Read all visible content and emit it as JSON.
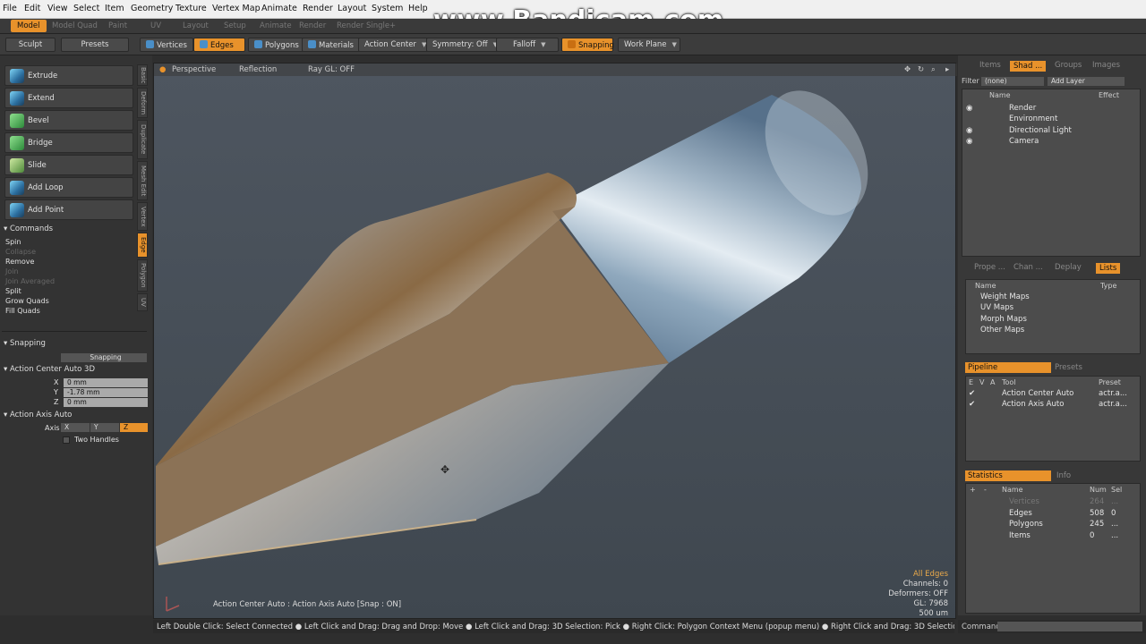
{
  "menu": [
    "File",
    "Edit",
    "View",
    "Select",
    "Item",
    "Geometry",
    "Texture",
    "Vertex Map",
    "Animate",
    "Render",
    "Layout",
    "System",
    "Help"
  ],
  "watermark": "www.Bandicam.com",
  "layout_tabs": [
    "Model",
    "Model Quad",
    "Paint",
    "UV",
    "Layout",
    "Setup",
    "Animate",
    "Render",
    "Render Single",
    "+"
  ],
  "toolbar": {
    "sculpt": "Sculpt",
    "presets": "Presets",
    "vertices": "Vertices",
    "edges": "Edges",
    "polygons": "Polygons",
    "materials": "Materials",
    "action_center": "Action Center",
    "symmetry": "Symmetry: Off",
    "falloff": "Falloff",
    "snapping": "Snapping",
    "work_plane": "Work Plane"
  },
  "tools": [
    "Extrude",
    "Extend",
    "Bevel",
    "Bridge",
    "Slide",
    "Add Loop",
    "Add Point"
  ],
  "vertical_tabs": [
    "Basic",
    "Deform",
    "Duplicate",
    "Mesh Edit",
    "Vertex",
    "Edge",
    "Polygon",
    "UV"
  ],
  "commands": {
    "header": "Commands",
    "items": [
      "Spin",
      "Collapse",
      "Remove",
      "Join",
      "Join Averaged",
      "Split",
      "Grow Quads",
      "Fill Quads"
    ],
    "disabled": [
      "Collapse",
      "Join",
      "Join Averaged"
    ]
  },
  "snapping": {
    "header": "Snapping",
    "field": "Snapping"
  },
  "action_center": {
    "header": "Action Center Auto 3D",
    "x_label": "X",
    "x": "0 mm",
    "y_label": "Y",
    "y": "-1.78 mm",
    "z_label": "Z",
    "z": "0 mm"
  },
  "action_axis": {
    "header": "Action Axis Auto",
    "axis_label": "Axis",
    "x": "X",
    "y": "Y",
    "z": "Z",
    "two_handles": "Two Handles"
  },
  "viewport": {
    "perspective": "Perspective",
    "reflection": "Reflection",
    "raygl": "Ray GL: OFF",
    "hud": "Action Center Auto : Action Axis Auto  [Snap : ON]",
    "info": [
      "All Edges",
      "Channels: 0",
      "Deformers: OFF",
      "GL: 7968",
      "500 um"
    ]
  },
  "right": {
    "top_tabs": [
      "Items",
      "Shad ...",
      "Groups",
      "Images"
    ],
    "filter_label": "Filter",
    "filter_value": "(none)",
    "add_layer": "Add Layer",
    "col_name": "Name",
    "col_effect": "Effect",
    "shader_items": [
      "Render",
      "Environment",
      "Directional Light",
      "Camera"
    ],
    "mid_tabs": [
      "Prope ...",
      "Chan ...",
      "Deplay",
      "Lists"
    ],
    "list_col_name": "Name",
    "list_col_type": "Type",
    "list_items": [
      "Weight Maps",
      "UV Maps",
      "Morph Maps",
      "Other Maps"
    ],
    "pipeline_tabs": [
      "Pipeline",
      "Presets"
    ],
    "pipeline_cols": [
      "E",
      "V",
      "A",
      "Tool",
      "Preset"
    ],
    "pipeline_rows": [
      {
        "tool": "Action Center Auto",
        "preset": "actr.a..."
      },
      {
        "tool": "Action Axis Auto",
        "preset": "actr.a..."
      }
    ],
    "stats_tabs": [
      "Statistics",
      "Info"
    ],
    "stats_cols": [
      "+",
      "-",
      "Name",
      "Num",
      "Sel"
    ],
    "stats_rows": [
      {
        "name": "Vertices",
        "num": "264",
        "sel": "...",
        "dim": true
      },
      {
        "name": "Edges",
        "num": "508",
        "sel": "0",
        "dim": false
      },
      {
        "name": "Polygons",
        "num": "245",
        "sel": "...",
        "dim": false
      },
      {
        "name": "Items",
        "num": "0",
        "sel": "...",
        "dim": false
      }
    ]
  },
  "status": "Left Double Click: Select Connected ● Left Click and Drag: Drag and Drop: Move ● Left Click and Drag: 3D Selection: Pick ● Right Click: Polygon Context Menu (popup menu) ● Right Click and Drag: 3D Selection: Area ● Middle Click and Dr ...",
  "command_label": "Command",
  "colors": {
    "accent": "#e8922b",
    "panel": "#383838",
    "viewport": "#4e5660"
  }
}
